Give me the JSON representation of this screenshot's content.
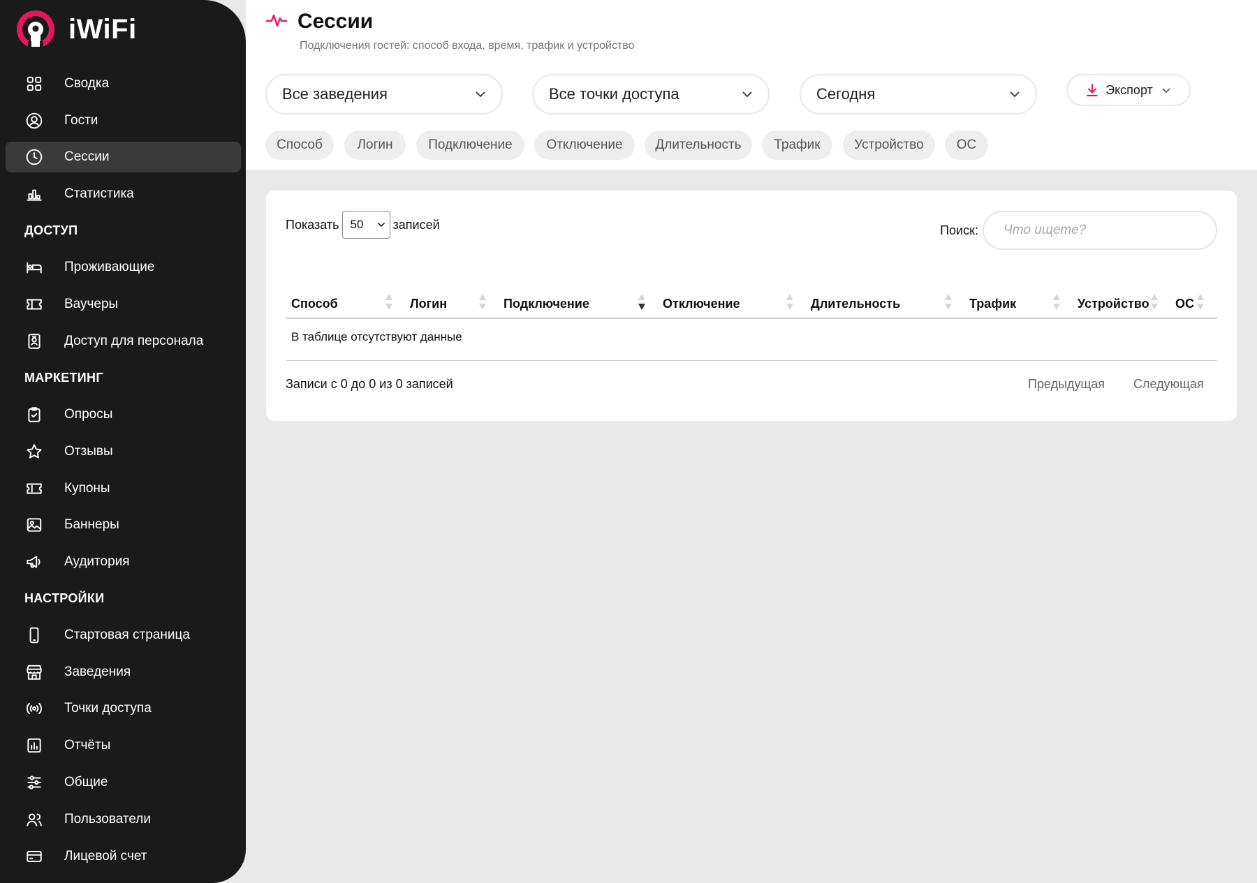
{
  "brand": {
    "name": "iWiFi",
    "accent": "#e8175d"
  },
  "sidebar": {
    "items": [
      {
        "label": "Сводка",
        "icon": "dashboard-icon"
      },
      {
        "label": "Гости",
        "icon": "user-circle-icon"
      },
      {
        "label": "Сессии",
        "icon": "clock-icon",
        "active": true
      },
      {
        "label": "Статистика",
        "icon": "bar-chart-icon"
      }
    ],
    "section_access": "ДОСТУП",
    "access_items": [
      {
        "label": "Проживающие",
        "icon": "bed-icon"
      },
      {
        "label": "Ваучеры",
        "icon": "ticket-icon"
      },
      {
        "label": "Доступ для персонала",
        "icon": "badge-icon"
      }
    ],
    "section_marketing": "МАРКЕТИНГ",
    "marketing_items": [
      {
        "label": "Опросы",
        "icon": "clipboard-icon"
      },
      {
        "label": "Отзывы",
        "icon": "star-icon"
      },
      {
        "label": "Купоны",
        "icon": "coupon-icon"
      },
      {
        "label": "Баннеры",
        "icon": "image-icon"
      },
      {
        "label": "Аудитория",
        "icon": "megaphone-icon"
      }
    ],
    "section_settings": "НАСТРОЙКИ",
    "settings_items": [
      {
        "label": "Стартовая страница",
        "icon": "phone-icon"
      },
      {
        "label": "Заведения",
        "icon": "store-icon"
      },
      {
        "label": "Точки доступа",
        "icon": "broadcast-icon"
      },
      {
        "label": "Отчёты",
        "icon": "report-icon"
      },
      {
        "label": "Общие",
        "icon": "sliders-icon"
      },
      {
        "label": "Пользователи",
        "icon": "users-icon"
      },
      {
        "label": "Лицевой счет",
        "icon": "card-icon"
      }
    ]
  },
  "header": {
    "title": "Сессии",
    "subtitle": "Подключения гостей: способ входа, время, трафик и устройство",
    "filters": {
      "venue": "Все заведения",
      "access_point": "Все точки доступа",
      "period": "Сегодня"
    },
    "export_label": "Экспорт",
    "chips": [
      "Способ",
      "Логин",
      "Подключение",
      "Отключение",
      "Длительность",
      "Трафик",
      "Устройство",
      "ОС"
    ]
  },
  "table": {
    "show_prefix": "Показать",
    "page_size": "50",
    "show_suffix": "записей",
    "search_label": "Поиск:",
    "search_placeholder": "Что ищете?",
    "columns": [
      "Способ",
      "Логин",
      "Подключение",
      "Отключение",
      "Длительность",
      "Трафик",
      "Устройство",
      "ОС"
    ],
    "sorted_column": "Подключение",
    "sort_direction": "desc",
    "empty_text": "В таблице отсутствуют данные",
    "info": "Записи с 0 до 0 из 0 записей",
    "prev_label": "Предыдущая",
    "next_label": "Следующая"
  }
}
